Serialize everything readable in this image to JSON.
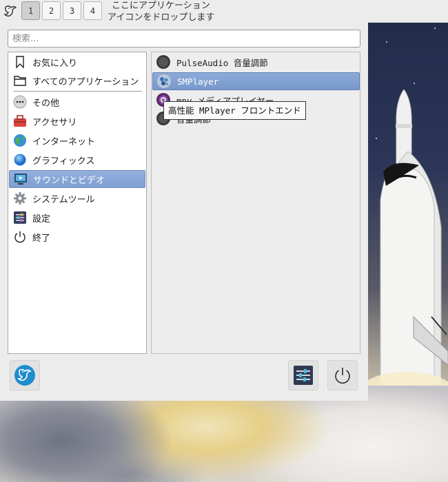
{
  "panel": {
    "workspaces": [
      "1",
      "2",
      "3",
      "4"
    ],
    "active_workspace": "1",
    "drop_hint_line1": "ここにアプリケーション",
    "drop_hint_line2": "アイコンをドロップします"
  },
  "search": {
    "placeholder": "検索...",
    "value": ""
  },
  "categories": [
    {
      "label": "お気に入り",
      "icon": "bookmark-icon"
    },
    {
      "label": "すべてのアプリケーション",
      "icon": "folder-icon"
    },
    {
      "label": "その他",
      "icon": "more-icon"
    },
    {
      "label": "アクセサリ",
      "icon": "toolbox-icon"
    },
    {
      "label": "インターネット",
      "icon": "globe-icon"
    },
    {
      "label": "グラフィックス",
      "icon": "graphics-icon"
    },
    {
      "label": "サウンドとビデオ",
      "icon": "monitor-icon",
      "selected": true
    },
    {
      "label": "システムツール",
      "icon": "gear-icon"
    },
    {
      "label": "設定",
      "icon": "settings-icon"
    },
    {
      "label": "終了",
      "icon": "power-icon"
    }
  ],
  "apps": [
    {
      "label": "PulseAudio 音量調節",
      "icon": "volume-icon"
    },
    {
      "label": "SMPlayer",
      "icon": "smplayer-icon",
      "selected": true
    },
    {
      "label": "mpv メディアプレイヤー",
      "icon": "mpv-icon"
    },
    {
      "label": "音量調節",
      "icon": "volume-icon"
    }
  ],
  "tooltip": "高性能 MPlayer フロントエンド",
  "colors": {
    "selection": "#7e9fd2",
    "panel_bg": "#ececec",
    "tooltip_border": "#333333"
  }
}
